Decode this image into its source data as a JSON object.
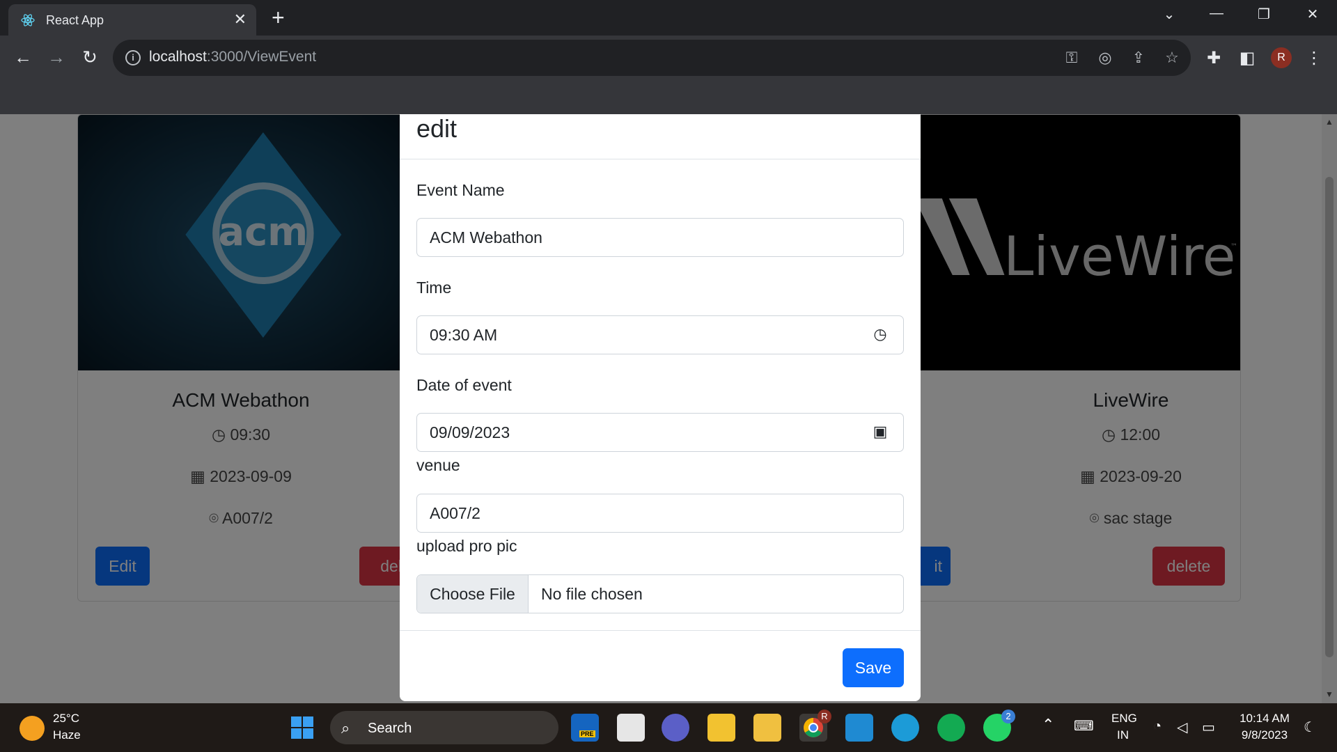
{
  "browser": {
    "tab_title": "React App",
    "url_host": "localhost",
    "url_path": ":3000/ViewEvent",
    "profile_initial": "R"
  },
  "cards": [
    {
      "title": "ACM Webathon",
      "time": "09:30",
      "date": "2023-09-09",
      "venue": "A007/2",
      "edit_label": "Edit",
      "delete_label": "dele",
      "logo_text": "acm"
    },
    {
      "title": "LiveWire",
      "time": "12:00",
      "date": "2023-09-20",
      "venue": "sac stage",
      "edit_label": "it",
      "delete_label": "delete",
      "logo_text": "LiveWire",
      "logo_tm": "™"
    }
  ],
  "modal": {
    "title": "edit",
    "event_name_label": "Event Name",
    "event_name_value": "ACM Webathon",
    "time_label": "Time",
    "time_value": "09:30  AM",
    "date_label": "Date of event",
    "date_value": "09/09/2023",
    "venue_label": "venue",
    "venue_value": "A007/2",
    "upload_label": "upload pro pic",
    "choose_file": "Choose File",
    "no_file": "No file chosen",
    "save_label": "Save"
  },
  "taskbar": {
    "temperature": "25°C",
    "weather": "Haze",
    "search_label": "Search",
    "language": "ENG",
    "region": "IN",
    "time": "10:14 AM",
    "date": "9/8/2023",
    "whatsapp_badge": "2",
    "chrome_badge": "R",
    "edge_pre_label": "PRE"
  },
  "colors": {
    "primary": "#0d6efd",
    "danger": "#dc3545",
    "chrome_dark": "#202124",
    "chrome_toolbar": "#35363a"
  }
}
